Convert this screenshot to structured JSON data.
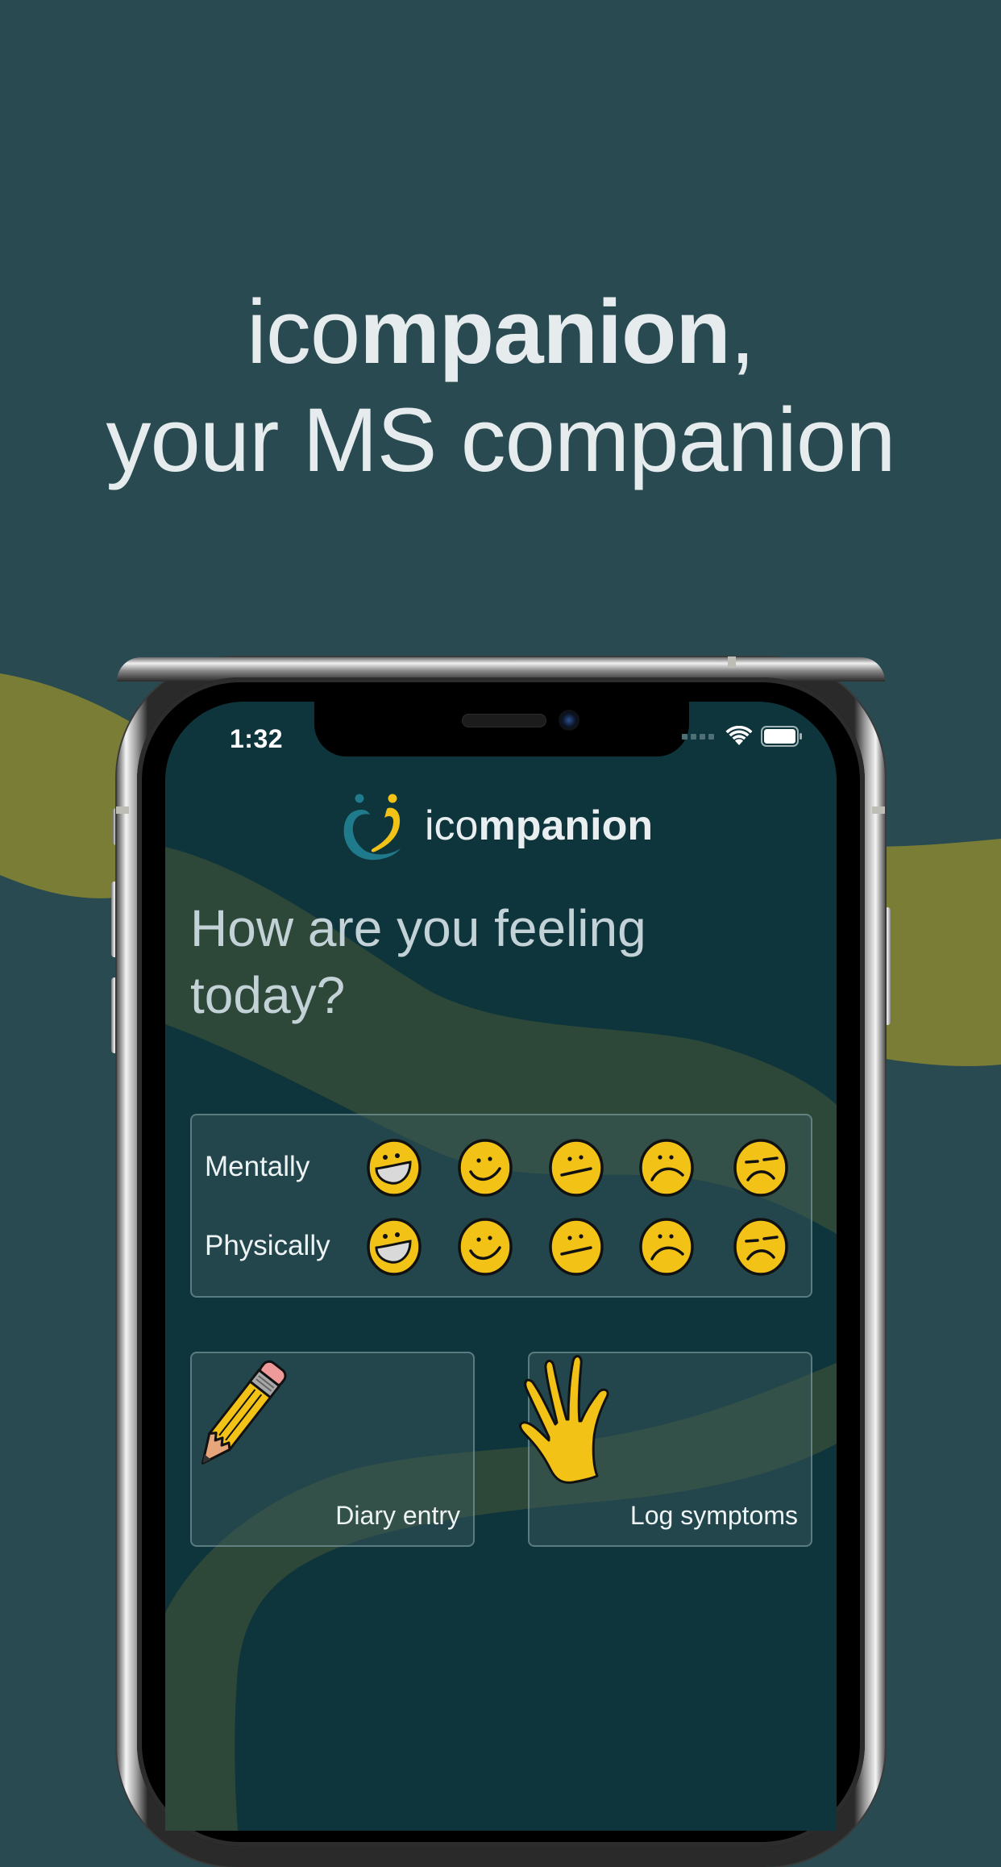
{
  "headline": {
    "line1_light": "ico",
    "line1_bold": "mpanion",
    "line1_suffix": ",",
    "line2": "your MS companion"
  },
  "colors": {
    "page_background": "#294a50",
    "screen_background": "#0f353c",
    "brush_stroke_outer": "#7a7d35",
    "brush_stroke_inner": "#2f4a38",
    "accent_yellow": "#f2c316",
    "logo_teal": "#1f7a8c",
    "text_light": "#e6ecee"
  },
  "status_bar": {
    "time": "1:32",
    "signal_icon": "signal-no-service-icon",
    "wifi_icon": "wifi-icon",
    "battery_icon": "battery-full-icon"
  },
  "app": {
    "logo": {
      "icon": "heart-figures-logo-icon",
      "text_light": "ico",
      "text_bold": "mpanion"
    },
    "heading_line1": "How are you feeling",
    "heading_line2": "today?",
    "mood_tracker": {
      "scale": [
        "very-happy",
        "happy",
        "neutral",
        "sad",
        "very-sad"
      ],
      "rows": [
        {
          "label": "Mentally"
        },
        {
          "label": "Physically"
        }
      ]
    },
    "actions": [
      {
        "label": "Diary entry",
        "icon": "pencil-icon"
      },
      {
        "label": "Log symptoms",
        "icon": "hand-icon"
      }
    ]
  }
}
